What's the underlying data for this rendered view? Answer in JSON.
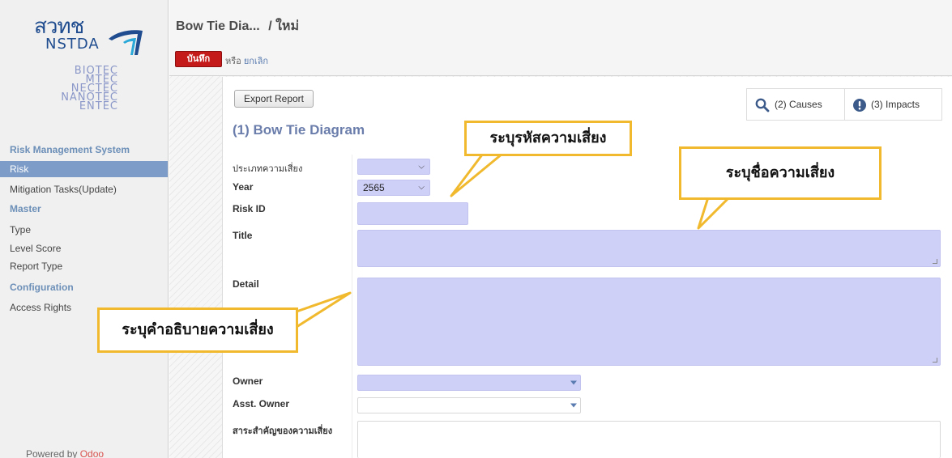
{
  "sidebar": {
    "logo": {
      "brand_line1": "สวทช",
      "brand_line2": "NSTDA",
      "institutes": [
        "BIOTEC",
        "MTEC",
        "NECTEC",
        "NANOTEC",
        "ENTEC"
      ]
    },
    "sections": [
      {
        "title": "Risk Management System",
        "items": [
          {
            "label": "Risk",
            "active": true
          },
          {
            "label": "Mitigation Tasks(Update)",
            "active": false
          }
        ]
      },
      {
        "title": "Master",
        "items": [
          {
            "label": "Type",
            "active": false
          },
          {
            "label": "Level Score",
            "active": false
          },
          {
            "label": "Report Type",
            "active": false
          }
        ]
      },
      {
        "title": "Configuration",
        "items": [
          {
            "label": "Access Rights",
            "active": false
          }
        ]
      }
    ],
    "powered_by_prefix": "Powered by",
    "powered_by_brand": "Odoo"
  },
  "header": {
    "breadcrumb_parent": "Bow Tie Dia...",
    "breadcrumb_sep": "/",
    "breadcrumb_current": "ใหม่",
    "save_label": "บันทึก",
    "or_label": "หรือ",
    "cancel_label": "ยกเลิก"
  },
  "toolbar": {
    "export_label": "Export Report",
    "causes_label": "(2) Causes",
    "impacts_label": "(3) Impacts"
  },
  "form": {
    "title": "(1) Bow Tie Diagram",
    "fields": {
      "risk_type_label": "ประเภทความเสี่ยง",
      "risk_type_value": "",
      "year_label": "Year",
      "year_value": "2565",
      "risk_id_label": "Risk ID",
      "risk_id_value": "",
      "title_label": "Title",
      "title_value": "",
      "detail_label": "Detail",
      "detail_value": "",
      "owner_label": "Owner",
      "owner_value": "",
      "asst_owner_label": "Asst. Owner",
      "asst_owner_value": "",
      "essence_label": "สาระสำคัญของความเสี่ยง",
      "essence_value": ""
    }
  },
  "callouts": {
    "risk_id": "ระบุรหัสความเสี่ยง",
    "risk_name": "ระบุชื่อความเสี่ยง",
    "risk_desc": "ระบุคำอธิบายความเสี่ยง"
  },
  "colors": {
    "accent": "#6a7dab",
    "save": "#c51a1a",
    "input_required": "#cfd0f8",
    "callout_border": "#f0b92e",
    "sidebar_active": "#7d9cc7"
  }
}
